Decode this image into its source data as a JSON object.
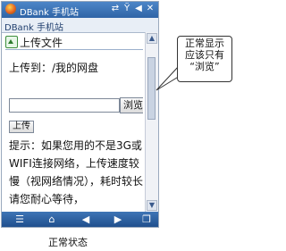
{
  "status_bar": {
    "title": "DBank 手机站",
    "icons": [
      "network-icon",
      "signal-icon",
      "volume-icon",
      "close-icon"
    ]
  },
  "url_bar": {
    "text": "DBank 手机站"
  },
  "page": {
    "section_title": "上传文件",
    "upload_to": "上传到：/我的网盘",
    "path_input_value": "",
    "browse_label": "浏览",
    "upload_label": "上传",
    "hint_text": "提示：如果您用的不是3G或WIFI连接网络，上传速度较慢（视网络情况），耗时较长请您耐心等待，"
  },
  "toolbar": {
    "buttons": [
      "menu-icon",
      "home-icon",
      "back-icon",
      "forward-icon",
      "windows-icon"
    ]
  },
  "annotation": {
    "callout_lines": [
      "正常显示",
      "应该只有",
      "“浏览”"
    ],
    "caption": "正常状态"
  },
  "colors": {
    "title_bar": "#2f64a6",
    "toolbar": "#1f4f8d",
    "callout_border": "#333333"
  }
}
